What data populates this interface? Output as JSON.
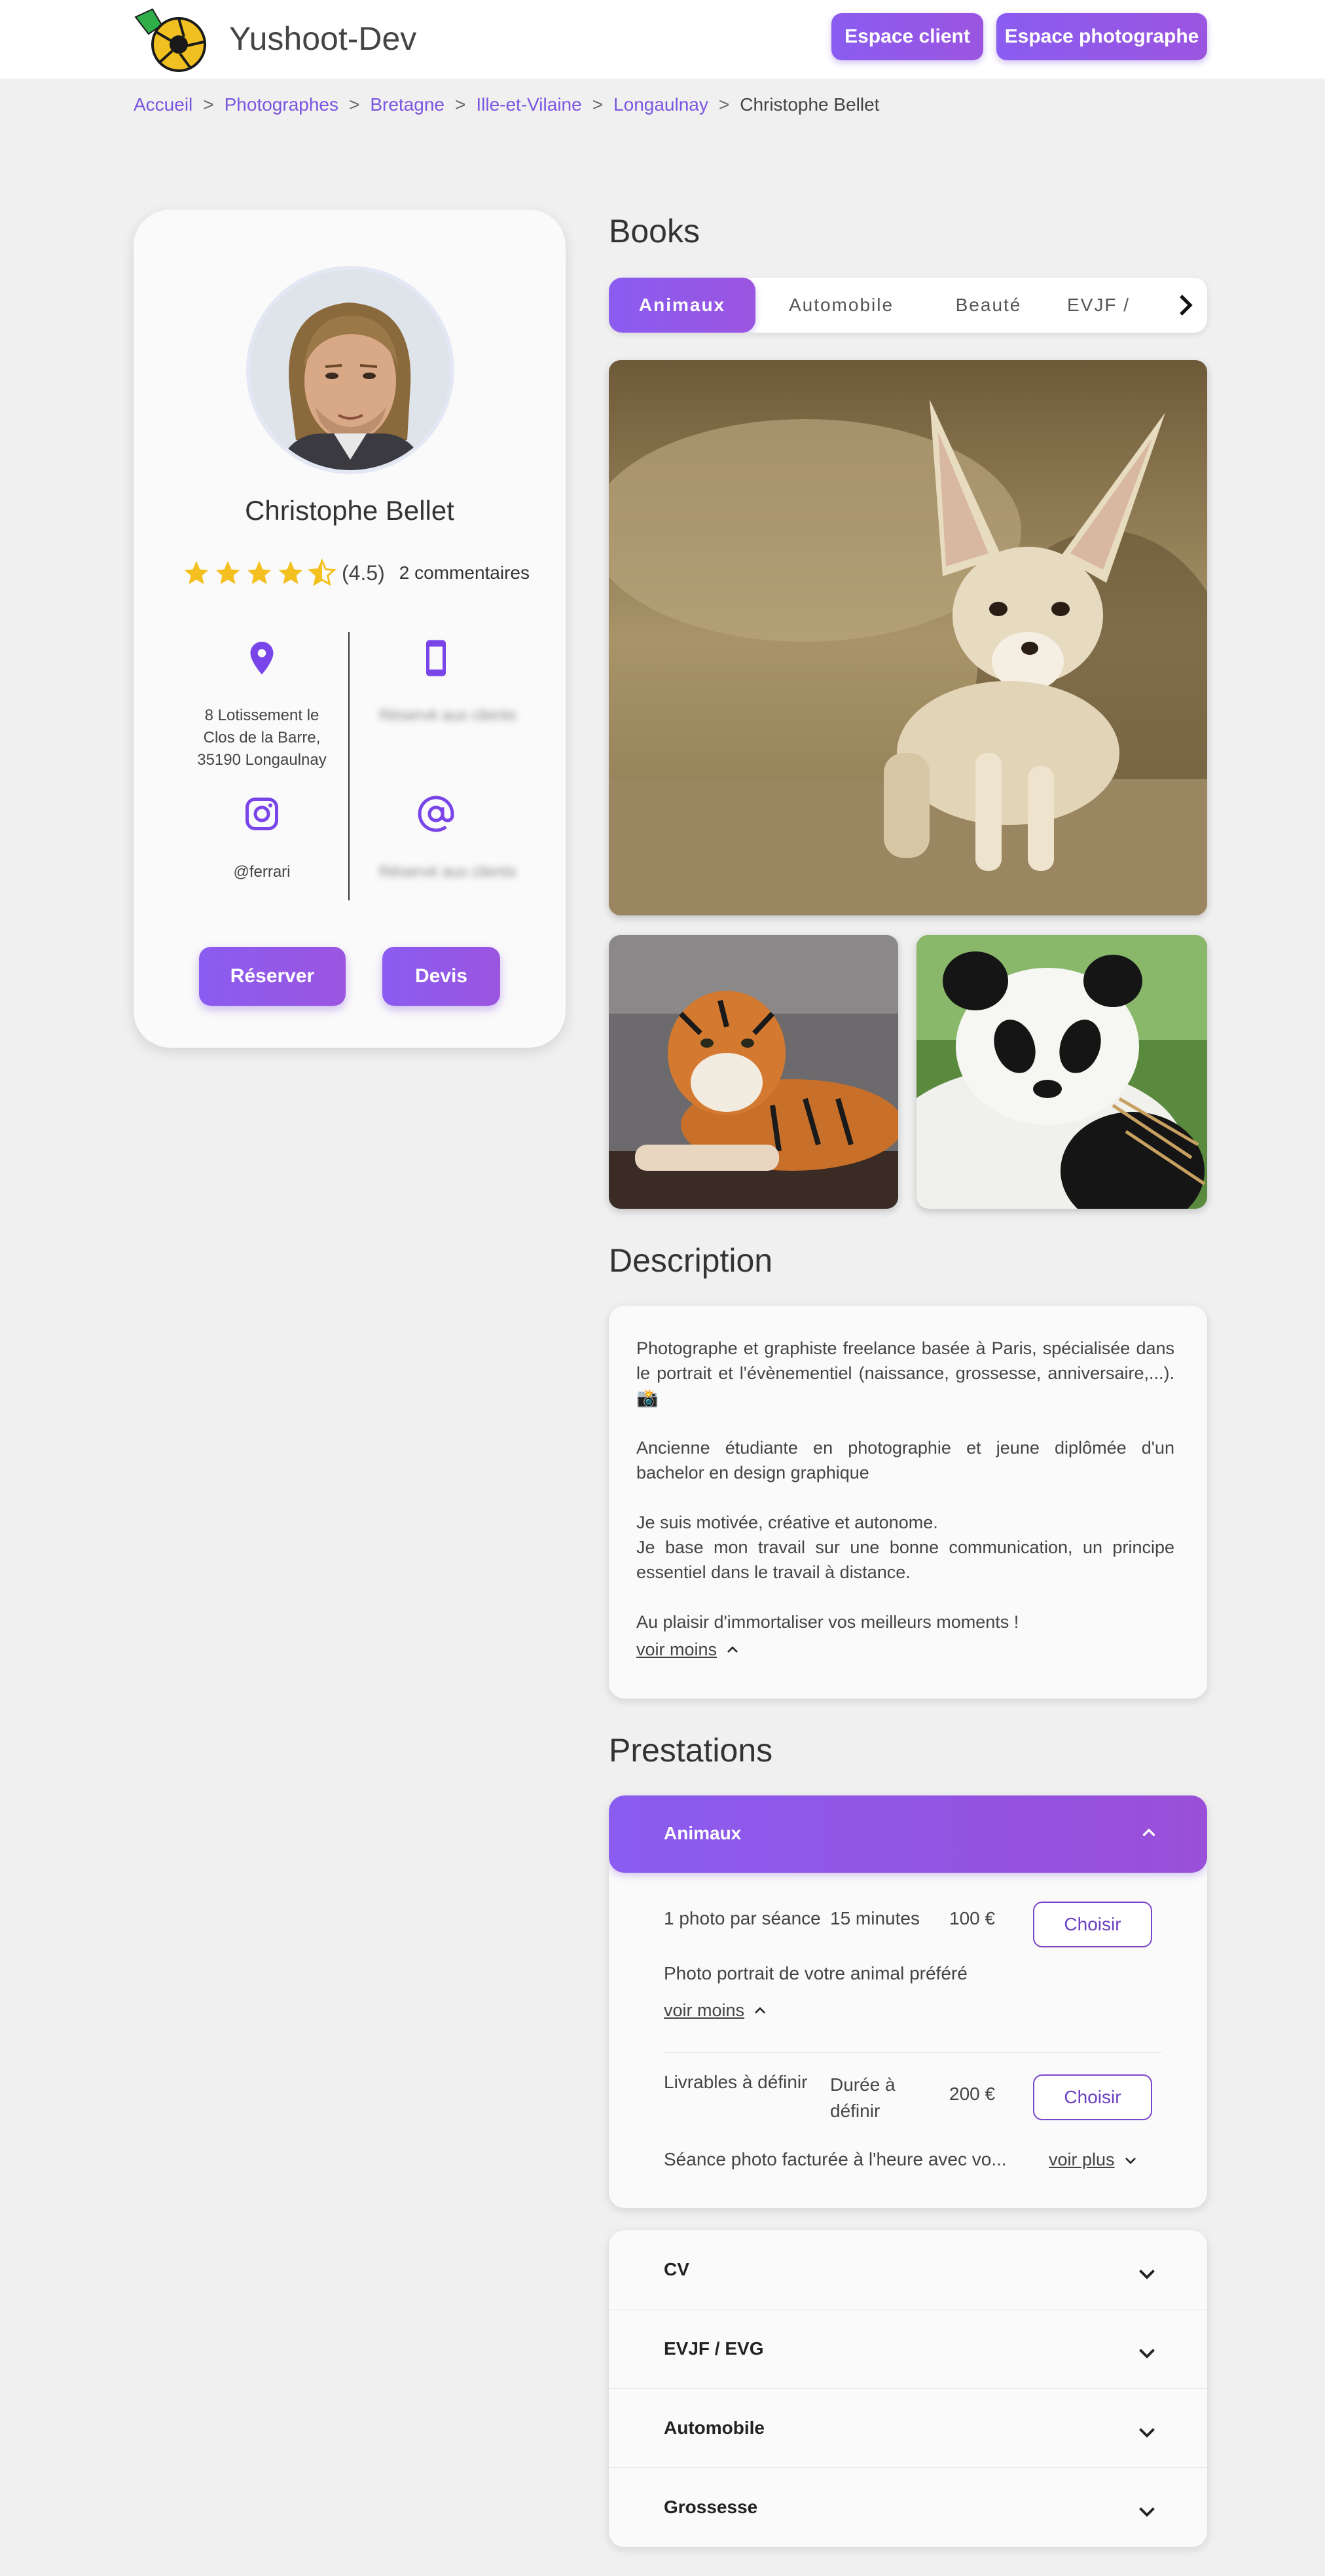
{
  "header": {
    "brand": "Yushoot-Dev",
    "client_button": "Espace client",
    "photographer_button": "Espace photographe"
  },
  "breadcrumb": [
    "Accueil",
    "Photographes",
    "Bretagne",
    "Ille-et-Vilaine",
    "Longaulnay",
    "Christophe Bellet"
  ],
  "profile": {
    "name": "Christophe Bellet",
    "rating": 4.5,
    "rating_label": "(4.5)",
    "comments": "2 commentaires",
    "address_line1": "8 Lotissement le",
    "address_line2": "Clos de la Barre,",
    "address_line3": "35190 Longaulnay",
    "phone_hidden": "Réservé aux clients",
    "instagram": "@ferrari",
    "email_hidden": "Réservé aux clients",
    "reserve_button": "Réserver",
    "quote_button": "Devis"
  },
  "books": {
    "title": "Books",
    "tabs": [
      "Animaux",
      "Automobile",
      "Beauté",
      "EVJF /"
    ],
    "active_tab": "Animaux"
  },
  "description": {
    "title": "Description",
    "paragraphs": [
      "Photographe et graphiste freelance basée à Paris, spécialisée dans le portrait et l'évènementiel (naissance, grossesse, anniversaire,...). 📸",
      "Ancienne étudiante en photographie et jeune diplômée d'un bachelor en design graphique",
      "Je suis motivée, créative et autonome.",
      "Je base mon travail sur une bonne communication, un principe essentiel dans le travail à distance.",
      "Au plaisir d'immortaliser vos meilleurs moments !"
    ],
    "toggle": "voir moins"
  },
  "prestations": {
    "title": "Prestations",
    "open_category": "Animaux",
    "items": [
      {
        "deliverable": "1 photo par séance",
        "duration": "15 minutes",
        "price": "100 €",
        "button": "Choisir",
        "detail": "Photo portrait de votre animal préféré",
        "toggle": "voir moins"
      },
      {
        "deliverable": "Livrables à définir",
        "duration_line1": "Durée à",
        "duration_line2": "définir",
        "price": "200 €",
        "button": "Choisir",
        "detail": "Séance photo facturée à l'heure avec vo...",
        "toggle": "voir plus"
      }
    ],
    "collapsed": [
      "CV",
      "EVJF / EVG",
      "Automobile",
      "Grossesse"
    ]
  },
  "colors": {
    "accent": "#8a5cf0",
    "link": "#7a55e0",
    "star": "#f4c020"
  }
}
